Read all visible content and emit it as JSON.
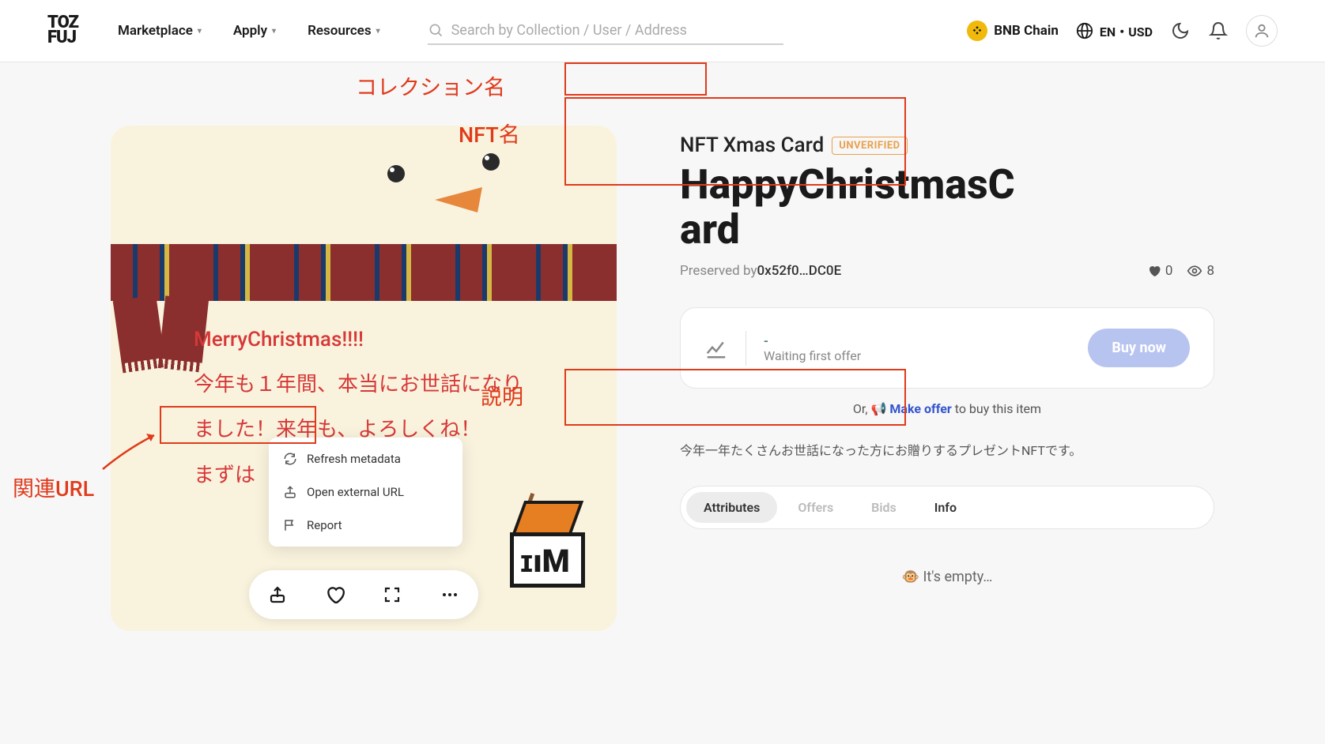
{
  "header": {
    "logo_line1": "TOZ",
    "logo_line2": "FUJ",
    "nav": [
      "Marketplace",
      "Apply",
      "Resources"
    ],
    "search_placeholder": "Search by Collection / User / Address",
    "chain": "BNB Chain",
    "locale": "EN・USD"
  },
  "card": {
    "line1": "MerryChristmas!!!!",
    "line2": "今年も１年間、本当にお世話になり",
    "line3": "ました！来年も、よろしくね！",
    "line4": "まずは"
  },
  "context_menu": {
    "refresh": "Refresh metadata",
    "open_url": "Open external URL",
    "report": "Report"
  },
  "nft": {
    "collection": "NFT Xmas Card",
    "badge": "UNVERIFIED",
    "title": "HappyChristmasCard",
    "preserved_label": "Preserved by ",
    "preserved_addr": "0x52f0…DC0E",
    "likes": "0",
    "views": "8",
    "price_dash": "-",
    "waiting": "Waiting first offer",
    "buy": "Buy now",
    "or_prefix": "Or, ",
    "make_offer": "Make offer",
    "or_suffix": " to buy this item",
    "description": "今年一年たくさんお世話になった方にお贈りするプレゼントNFTです。"
  },
  "tabs": {
    "attributes": "Attributes",
    "offers": "Offers",
    "bids": "Bids",
    "info": "Info"
  },
  "empty": "🐵 It's empty…",
  "annotations": {
    "collection": "コレクション名",
    "nft_name": "NFT名",
    "description": "説明",
    "related_url": "関連URL"
  }
}
